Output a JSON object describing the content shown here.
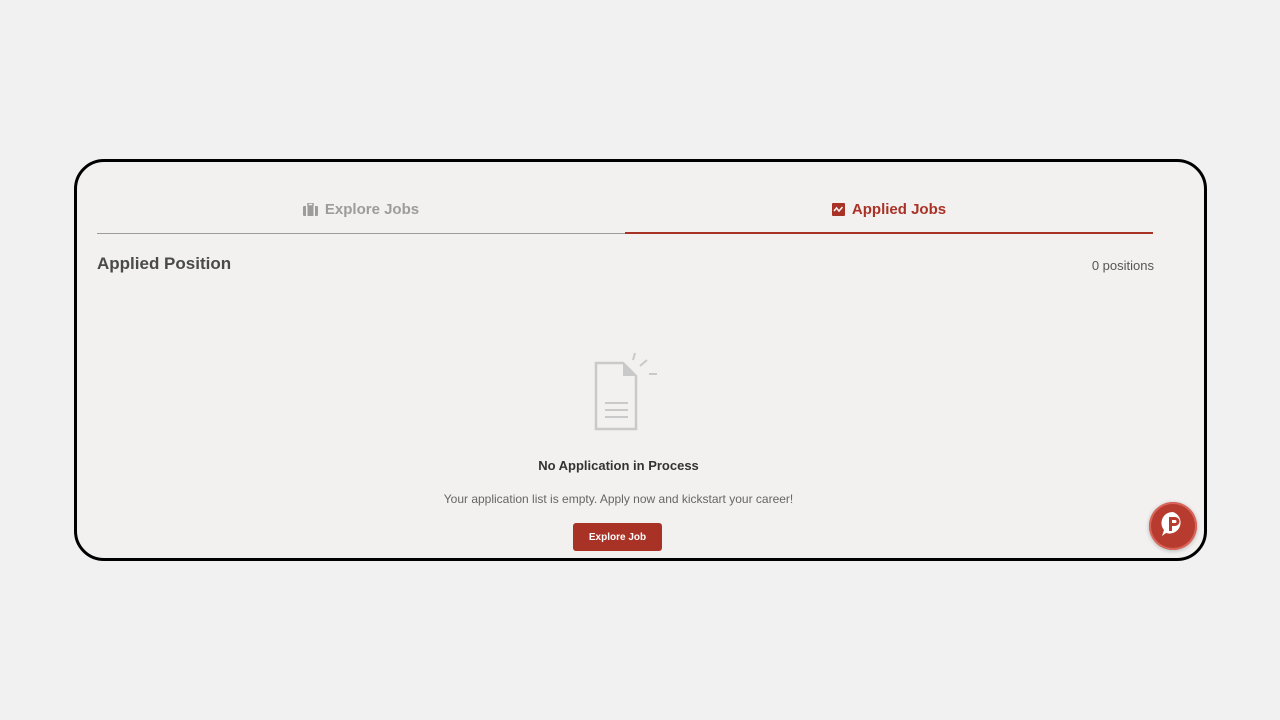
{
  "tabs": [
    {
      "label": "Explore Jobs",
      "icon": "briefcase-icon",
      "active": false
    },
    {
      "label": "Applied Jobs",
      "icon": "activity-chart-icon",
      "active": true
    }
  ],
  "section": {
    "title": "Applied Position",
    "count": "0 positions"
  },
  "empty_state": {
    "icon": "document-icon",
    "title": "No Application in Process",
    "description": "Your application list is empty. Apply now and kickstart your career!",
    "button_label": "Explore Job"
  },
  "chat_widget": {
    "icon": "chat-bubble-p-icon"
  },
  "colors": {
    "accent": "#a93226",
    "inactive": "#9c9c9c",
    "background": "#f2f1f0"
  }
}
